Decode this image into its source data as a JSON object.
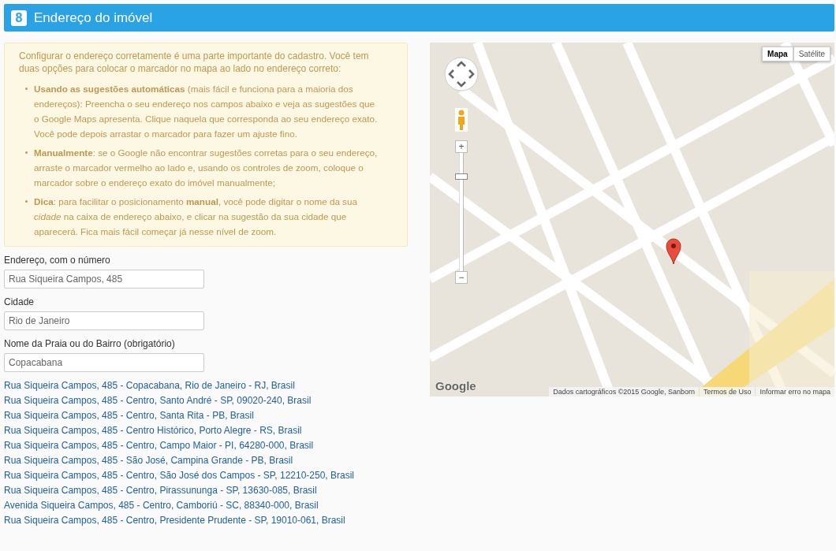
{
  "header": {
    "step": "8",
    "title": "Endereço do imóvel"
  },
  "info": {
    "intro": "Configurar o endereço corretamente é uma parte importante do cadastro. Você tem duas opções para colocar o marcador no mapa ao lado no endereço correto:",
    "bullets": [
      "**Usando as sugestões automáticas** (mais fácil e funciona para a maioria dos endereços): Preencha o seu endereço nos campos abaixo e veja as sugestões que o Google Maps apresenta. Clique naquela que corresponda ao seu endereço exato. Você pode depois arrastar o marcador para fazer um ajuste fino.",
      "**Manualmente**: se o Google não encontrar sugestões corretas para o seu endereço, arraste o marcador vermelho ao lado e, usando os controles de zoom, coloque o marcador sobre o endereço exato do imóvel manualmente;",
      "**Dica**: para facilitar o posicionamento **manual**, você pode digitar o nome da sua *cidade* na caixa de endereço abaixo, e clicar na sugestão da sua cidade que aparecerá. Fica mais fácil começar já nesse nível de zoom."
    ]
  },
  "fields": [
    {
      "label": "Endereço, com o número",
      "value": "Rua Siqueira Campos, 485"
    },
    {
      "label": "Cidade",
      "value": "Rio de Janeiro"
    },
    {
      "label": "Nome da Praia ou do Bairro (obrigatório)",
      "value": "Copacabana"
    }
  ],
  "suggestions": [
    "Rua Siqueira Campos, 485 - Copacabana, Rio de Janeiro - RJ, Brasil",
    "Rua Siqueira Campos, 485 - Centro, Santo André - SP, 09020-240, Brasil",
    "Rua Siqueira Campos, 485 - Centro, Santa Rita - PB, Brasil",
    "Rua Siqueira Campos, 485 - Centro Histórico, Porto Alegre - RS, Brasil",
    "Rua Siqueira Campos, 485 - Centro, Campo Maior - PI, 64280-000, Brasil",
    "Rua Siqueira Campos, 485 - São José, Campina Grande - PB, Brasil",
    "Rua Siqueira Campos, 485 - Centro, São José dos Campos - SP, 12210-250, Brasil",
    "Rua Siqueira Campos, 485 - Centro, Pirassununga - SP, 13630-085, Brasil",
    "Avenida Siqueira Campos, 485 - Centro, Camboriú - SC, 88340-000, Brasil",
    "Rua Siqueira Campos, 485 - Centro, Presidente Prudente - SP, 19010-061, Brasil"
  ],
  "map": {
    "map_types": [
      {
        "label": "Mapa",
        "selected": true
      },
      {
        "label": "Satélite",
        "selected": false
      }
    ],
    "zoom_in": "+",
    "zoom_out": "−",
    "zoom": {
      "level": 0.8
    },
    "logo": "Google",
    "attribution": "Dados cartográficos ©2015 Google, Sanborn",
    "terms": "Termos de Uso",
    "report": "Informar erro no mapa"
  }
}
